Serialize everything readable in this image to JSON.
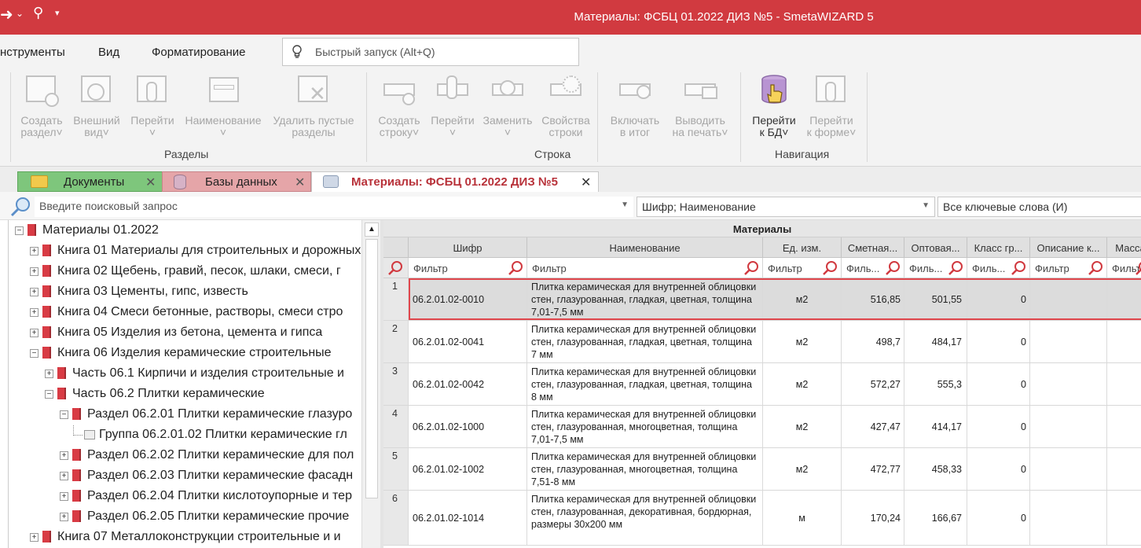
{
  "window": {
    "title": "Материалы: ФСБЦ 01.2022 ДИЗ №5 - SmetaWIZARD 5"
  },
  "menu": {
    "items": [
      "нструменты",
      "Вид",
      "Форматирование"
    ]
  },
  "quick_launch": {
    "placeholder": "Быстрый запуск (Alt+Q)"
  },
  "ribbon": {
    "groups": [
      {
        "label": "Разделы",
        "buttons": [
          {
            "line1": "Создать",
            "line2": "раздел˅"
          },
          {
            "line1": "Внешний",
            "line2": "вид˅"
          },
          {
            "line1": "Перейти",
            "line2": "˅"
          },
          {
            "line1": "Наименование",
            "line2": "˅"
          },
          {
            "line1": "Удалить пустые",
            "line2": "разделы"
          }
        ]
      },
      {
        "label": "Строка",
        "buttons": [
          {
            "line1": "Создать",
            "line2": "строку˅"
          },
          {
            "line1": "Перейти",
            "line2": "˅"
          },
          {
            "line1": "Заменить",
            "line2": "˅"
          },
          {
            "line1": "Свойства",
            "line2": "строки"
          }
        ]
      },
      {
        "label": "",
        "buttons": [
          {
            "line1": "Включать",
            "line2": "в итог"
          },
          {
            "line1": "Выводить",
            "line2": "на печать˅"
          }
        ]
      },
      {
        "label": "Навигация",
        "buttons": [
          {
            "line1": "Перейти",
            "line2": "к БД˅"
          },
          {
            "line1": "Перейти",
            "line2": "к форме˅"
          }
        ]
      }
    ]
  },
  "tabs": [
    {
      "label": "Документы",
      "color": "#7ec67c"
    },
    {
      "label": "Базы данных",
      "color": "#e5a5a8"
    },
    {
      "label": "Материалы: ФСБЦ 01.2022 ДИЗ №5",
      "color": "#ffffff"
    }
  ],
  "search": {
    "placeholder": "Введите поисковый запрос",
    "field_mode": "Шифр; Наименование",
    "keyword_mode": "Все ключевые слова (И)"
  },
  "tree": [
    {
      "label": "Материалы 01.2022",
      "exp": "−"
    },
    {
      "label": "Книга 01 Материалы для строительных и дорожных",
      "exp": "+"
    },
    {
      "label": "Книга 02 Щебень, гравий, песок, шлаки, смеси, г",
      "exp": "+"
    },
    {
      "label": "Книга 03 Цементы, гипс, известь",
      "exp": "+"
    },
    {
      "label": "Книга 04 Смеси бетонные, растворы, смеси стро",
      "exp": "+"
    },
    {
      "label": "Книга 05 Изделия из бетона, цемента и гипса",
      "exp": "+"
    },
    {
      "label": "Книга 06 Изделия керамические строительные",
      "exp": "−"
    },
    {
      "label": "Часть 06.1 Кирпичи и изделия строительные и",
      "exp": "+"
    },
    {
      "label": "Часть 06.2 Плитки керамические",
      "exp": "−"
    },
    {
      "label": "Раздел 06.2.01 Плитки керамические глазуро",
      "exp": "−"
    },
    {
      "label": "Группа 06.2.01.02 Плитки керамические гл",
      "exp": ""
    },
    {
      "label": "Раздел 06.2.02 Плитки керамические для пол",
      "exp": "+"
    },
    {
      "label": "Раздел 06.2.03 Плитки керамические фасадн",
      "exp": "+"
    },
    {
      "label": "Раздел 06.2.04 Плитки кислотоупорные и тер",
      "exp": "+"
    },
    {
      "label": "Раздел 06.2.05 Плитки керамические прочие",
      "exp": "+"
    },
    {
      "label": "Книга 07 Металлоконструкции строительные и и",
      "exp": "+"
    }
  ],
  "grid": {
    "title": "Материалы",
    "columns": [
      "Шифр",
      "Наименование",
      "Ед. изм.",
      "Сметная...",
      "Оптовая...",
      "Класс гр...",
      "Описание к...",
      "Масса"
    ],
    "filters": [
      "Фильтр",
      "Фильтр",
      "Фильтр",
      "Филь...",
      "Филь...",
      "Филь...",
      "Фильтр",
      "Фильт"
    ],
    "rows": [
      {
        "n": "1",
        "code": "06.2.01.02-0010",
        "name": "Плитка керамическая для внутренней облицовки стен, глазурованная, гладкая, цветная, толщина 7,01-7,5 мм",
        "unit": "м2",
        "est": "516,85",
        "whole": "501,55",
        "cls": "0"
      },
      {
        "n": "2",
        "code": "06.2.01.02-0041",
        "name": "Плитка керамическая для внутренней облицовки стен, глазурованная, гладкая, цветная, толщина 7 мм",
        "unit": "м2",
        "est": "498,7",
        "whole": "484,17",
        "cls": "0"
      },
      {
        "n": "3",
        "code": "06.2.01.02-0042",
        "name": "Плитка керамическая для внутренней облицовки стен, глазурованная, гладкая, цветная, толщина 8 мм",
        "unit": "м2",
        "est": "572,27",
        "whole": "555,3",
        "cls": "0"
      },
      {
        "n": "4",
        "code": "06.2.01.02-1000",
        "name": "Плитка керамическая для внутренней облицовки стен, глазурованная, многоцветная, толщина 7,01-7,5 мм",
        "unit": "м2",
        "est": "427,47",
        "whole": "414,17",
        "cls": "0"
      },
      {
        "n": "5",
        "code": "06.2.01.02-1002",
        "name": "Плитка керамическая для внутренней облицовки стен, глазурованная, многоцветная, толщина 7,51-8 мм",
        "unit": "м2",
        "est": "472,77",
        "whole": "458,33",
        "cls": "0"
      },
      {
        "n": "6",
        "code": "06.2.01.02-1014",
        "name": "Плитка керамическая для внутренней облицовки стен, глазурованная, декоративная, бордюрная, размеры 30х200 мм",
        "unit": "м",
        "est": "170,24",
        "whole": "166,67",
        "cls": "0"
      }
    ]
  },
  "colors": {
    "titlebar": "#d13a40",
    "selection_border": "#e0474d",
    "book_icon": "#d83b44"
  }
}
